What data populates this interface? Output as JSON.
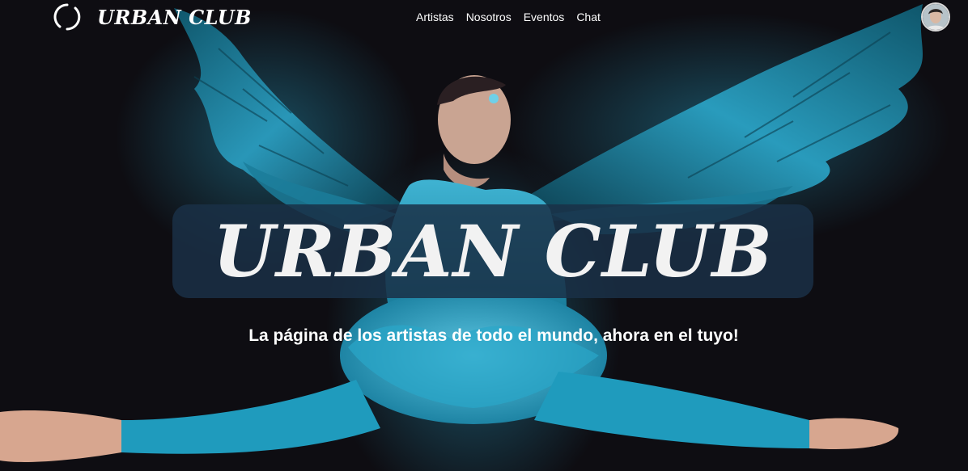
{
  "nav": {
    "brand_name": "URBAN CLUB",
    "brand_icon": "circle-swirl-icon",
    "links": [
      {
        "label": "Artistas"
      },
      {
        "label": "Nosotros"
      },
      {
        "label": "Eventos"
      },
      {
        "label": "Chat"
      }
    ],
    "avatar_icon": "user-avatar"
  },
  "hero": {
    "title": "URBAN CLUB",
    "subtitle": "La página de los artistas de todo el mundo, ahora en el tuyo!",
    "background_image": "ballet dancer with blue feathered wings, mid-leap split"
  },
  "colors": {
    "background": "#0e0d12",
    "accent": "#2a9bbd",
    "title_box": "#1a3046",
    "text": "#ffffff"
  }
}
